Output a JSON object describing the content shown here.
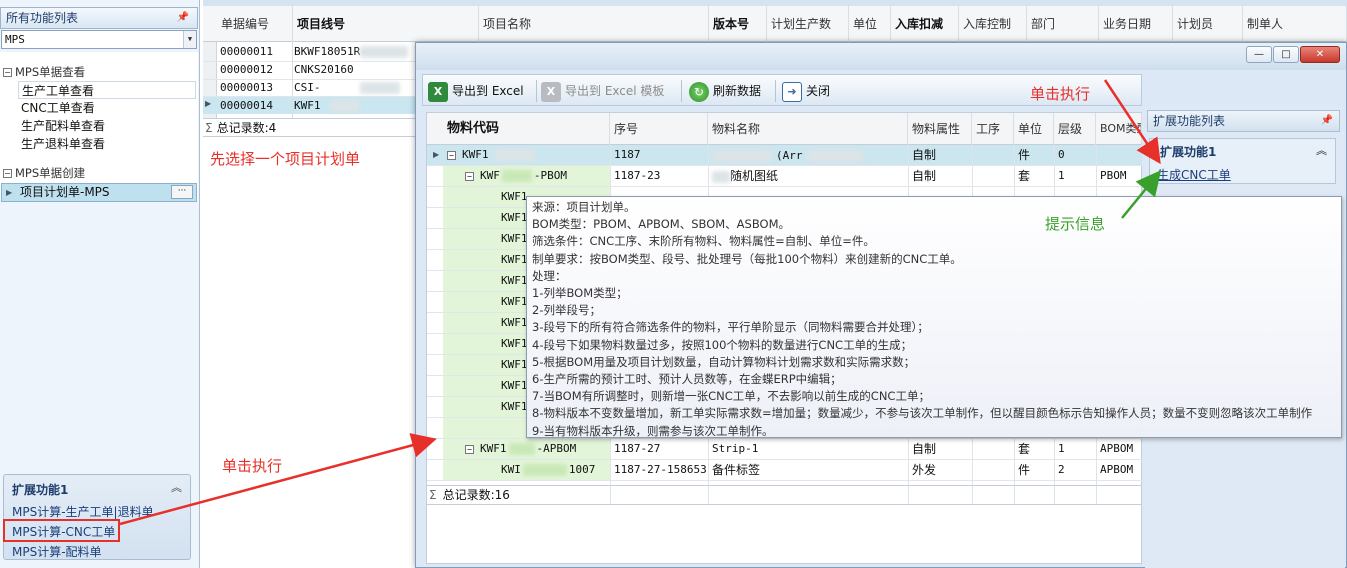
{
  "left_panel": {
    "title": "所有功能列表",
    "select_value": "MPS",
    "groups": [
      {
        "label": "MPS单据查看",
        "items": [
          "生产工单查看",
          "CNC工单查看",
          "生产配料单查看",
          "生产退料单查看"
        ]
      },
      {
        "label": "MPS单据创建",
        "items": [
          "项目计划单-MPS"
        ]
      }
    ],
    "ext_panel": {
      "title": "扩展功能1",
      "links": [
        "MPS计算-生产工单|退料单",
        "MPS计算-CNC工单",
        "MPS计算-配料单"
      ]
    }
  },
  "bg_grid": {
    "headers": [
      "单据编号",
      "项目线号",
      "项目名称",
      "版本号",
      "计划生产数",
      "单位",
      "入库扣减",
      "入库控制",
      "部门",
      "业务日期",
      "计划员",
      "制单人"
    ],
    "bold_headers": [
      "项目线号",
      "版本号",
      "入库扣减"
    ],
    "rows": [
      {
        "no": "00000011",
        "line": "BKWF18051R-"
      },
      {
        "no": "00000012",
        "line": "CNKS20160"
      },
      {
        "no": "00000013",
        "line": "CSI-"
      },
      {
        "no": "00000014",
        "line": "KWF1"
      }
    ],
    "summary": "总记录数:4"
  },
  "dialog": {
    "window_buttons": [
      "—",
      "□",
      "✕"
    ],
    "toolbar": {
      "export_excel": "导出到 Excel",
      "export_template": "导出到 Excel 模板",
      "refresh": "刷新数据",
      "close": "关闭"
    },
    "grid": {
      "headers": [
        "物料代码",
        "序号",
        "物料名称",
        "物料属性",
        "工序",
        "单位",
        "层级",
        "BOM类型"
      ],
      "rows": [
        {
          "code": "KWF1",
          "seq": "1187",
          "name": "",
          "name_tail": "(Arr",
          "attr": "自制",
          "unit": "件",
          "level": "0",
          "bom": ""
        },
        {
          "code": "KWF",
          "code_tail": "-PBOM",
          "seq": "1187-23",
          "name": "",
          "name_tail": "随机图纸",
          "attr": "自制",
          "unit": "套",
          "level": "1",
          "bom": "PBOM"
        },
        {
          "code": "KWF1"
        },
        {
          "code": "KWF1"
        },
        {
          "code": "KWF1"
        },
        {
          "code": "KWF1"
        },
        {
          "code": "KWF1"
        },
        {
          "code": "KWF1"
        },
        {
          "code": "KWF1"
        },
        {
          "code": "KWF1"
        },
        {
          "code": "KWF1"
        },
        {
          "code": "KWF1"
        },
        {
          "code": "KWF1"
        },
        {
          "code": "KWF1",
          "code_tail": "-APBOM",
          "seq": "1187-27",
          "name": "Strip-1",
          "attr": "自制",
          "unit": "套",
          "level": "1",
          "bom": "APBOM"
        },
        {
          "code": "KWI",
          "code_tail": "1007",
          "seq": "1187-27-158653",
          "name": "备件标签",
          "attr": "外发",
          "unit": "件",
          "level": "2",
          "bom": "APBOM"
        }
      ],
      "summary": "总记录数:16"
    }
  },
  "right_panel": {
    "title": "扩展功能列表",
    "box_title": "扩展功能1",
    "link": "生成CNC工单"
  },
  "tooltip": {
    "lines": [
      "来源：项目计划单。",
      "BOM类型：PBOM、APBOM、SBOM、ASBOM。",
      "筛选条件：CNC工序、末阶所有物料、物料属性=自制、单位=件。",
      "制单要求：按BOM类型、段号、批处理号（每批100个物料）来创建新的CNC工单。",
      "处理：",
      "1-列举BOM类型；",
      "2-列举段号；",
      "3-段号下的所有符合筛选条件的物料，平行单阶显示（同物料需要合并处理）；",
      "4-段号下如果物料数量过多，按照100个物料的数量进行CNC工单的生成；",
      "5-根据BOM用量及项目计划数量，自动计算物料计划需求数和实际需求数；",
      "6-生产所需的预计工时、预计人员数等，在金蝶ERP中编辑；",
      "7-当BOM有所调整时，则新增一张CNC工单，不去影响以前生成的CNC工单；",
      "8-物料版本不变数量增加，新工单实际需求数=增加量；数量减少，不参与该次工单制作，但以醒目颜色标示告知操作人员；数量不变则忽略该次工单制作",
      "9-当有物料版本升级，则需参与该次工单制作。"
    ]
  },
  "annotations": {
    "select_first": "先选择一个项目计划单",
    "click_left": "单击执行",
    "click_right": "单击执行",
    "hint": "提示信息"
  },
  "colors": {
    "annotation_red": "#e8302a",
    "annotation_green": "#3aa02c"
  }
}
